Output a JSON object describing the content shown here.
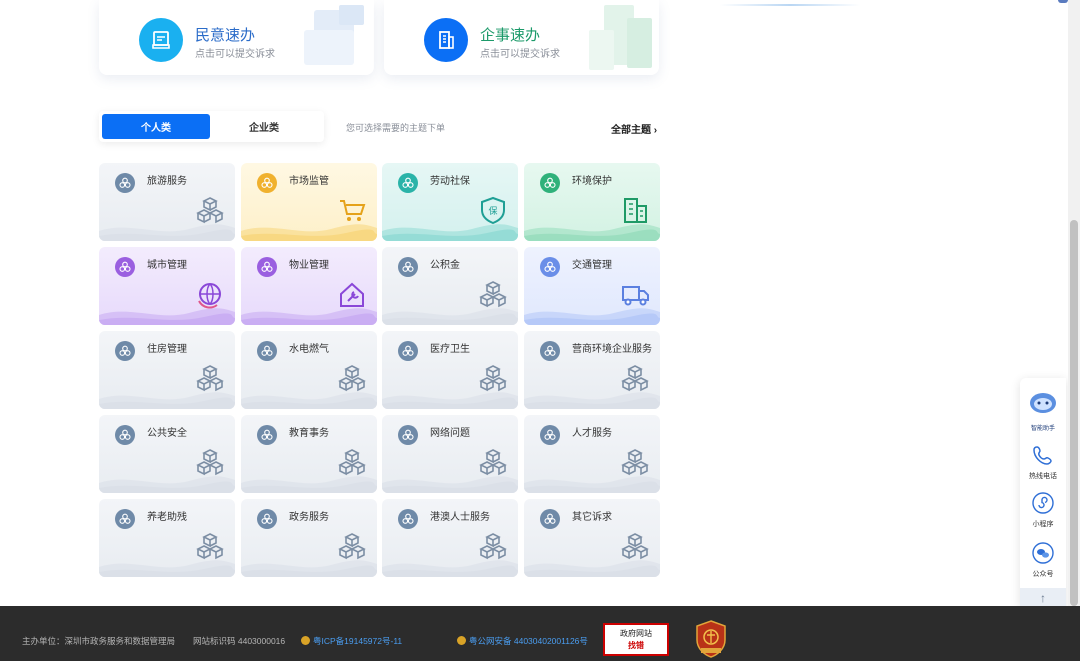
{
  "quick": [
    {
      "title": "民意速办",
      "sub": "点击可以提交诉求",
      "color": "#1ab0f0",
      "title_color": "#2b6cc9",
      "icon": "envelope-icon"
    },
    {
      "title": "企事速办",
      "sub": "点击可以提交诉求",
      "color": "#0b6ff5",
      "title_color": "#1c9a6a",
      "icon": "building-icon"
    }
  ],
  "tabs": {
    "personal": "个人类",
    "enterprise": "企业类"
  },
  "hint": "您可选择需要的主题下单",
  "all_topics": "全部主题 ›",
  "tiles": [
    {
      "label": "旅游服务",
      "theme": "gray"
    },
    {
      "label": "市场监管",
      "theme": "yellow"
    },
    {
      "label": "劳动社保",
      "theme": "teal"
    },
    {
      "label": "环境保护",
      "theme": "green"
    },
    {
      "label": "城市管理",
      "theme": "purple"
    },
    {
      "label": "物业管理",
      "theme": "purple"
    },
    {
      "label": "公积金",
      "theme": "gray"
    },
    {
      "label": "交通管理",
      "theme": "blue"
    },
    {
      "label": "住房管理",
      "theme": "gray"
    },
    {
      "label": "水电燃气",
      "theme": "gray"
    },
    {
      "label": "医疗卫生",
      "theme": "gray"
    },
    {
      "label": "营商环境企业服务",
      "theme": "gray"
    },
    {
      "label": "公共安全",
      "theme": "gray"
    },
    {
      "label": "教育事务",
      "theme": "gray"
    },
    {
      "label": "网络问题",
      "theme": "gray"
    },
    {
      "label": "人才服务",
      "theme": "gray"
    },
    {
      "label": "养老助残",
      "theme": "gray"
    },
    {
      "label": "政务服务",
      "theme": "gray"
    },
    {
      "label": "港澳人士服务",
      "theme": "gray"
    },
    {
      "label": "其它诉求",
      "theme": "gray"
    }
  ],
  "float_bar": {
    "assistant": "智能助手",
    "hotline": "热线电话",
    "miniapp": "小程序",
    "official": "公众号",
    "up": "↑"
  },
  "footer": {
    "sponsor": "主办单位：深圳市政务服务和数据管理局",
    "site_code": "网站标识码 4403000016",
    "icp": "粤ICP备19145972号-11",
    "police": "粤公网安备 44030402001126号",
    "gov_line1": "政府网站",
    "gov_line2": "找错",
    "shield_label": "网站纠错"
  }
}
